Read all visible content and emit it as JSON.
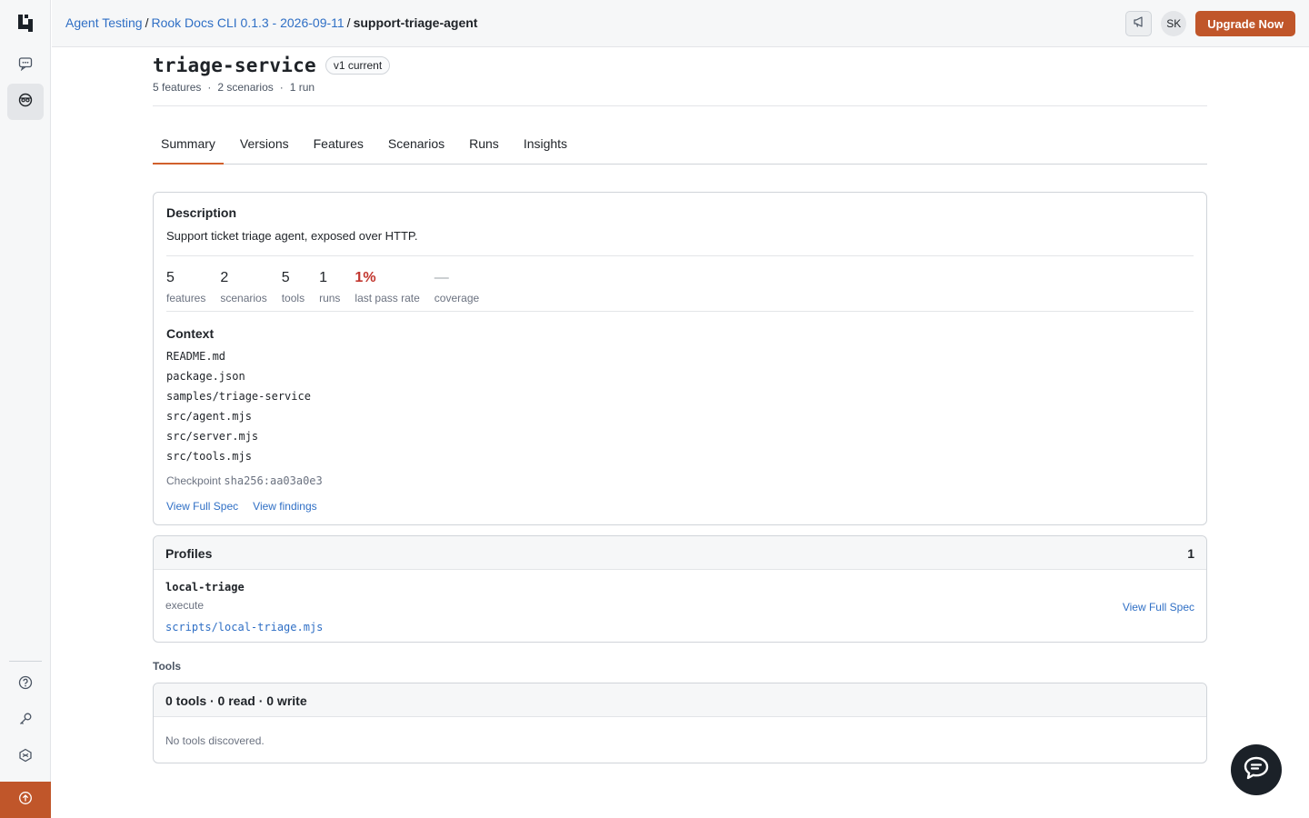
{
  "breadcrumb": {
    "items": [
      "Agent Testing",
      "Rook Docs CLI 0.1.3 - 2026-09-11"
    ],
    "separator": "/",
    "current": "support-triage-agent"
  },
  "header": {
    "avatar_initials": "SK",
    "upgrade_label": "Upgrade Now"
  },
  "service": {
    "title": "triage-service",
    "version_badge": "v1 current",
    "meta": [
      "5 features",
      "2 scenarios",
      "1 run"
    ],
    "meta_separator": "·"
  },
  "tabs": [
    {
      "label": "Summary",
      "active": true
    },
    {
      "label": "Versions"
    },
    {
      "label": "Features"
    },
    {
      "label": "Scenarios"
    },
    {
      "label": "Runs"
    },
    {
      "label": "Insights"
    }
  ],
  "summary": {
    "description_title": "Description",
    "description": "Support ticket triage agent, exposed over HTTP.",
    "stats": [
      {
        "value": "5",
        "label": "features"
      },
      {
        "value": "2",
        "label": "scenarios"
      },
      {
        "value": "5",
        "label": "tools"
      },
      {
        "value": "1",
        "label": "runs"
      },
      {
        "value": "1%",
        "label": "last pass rate"
      },
      {
        "value": "—",
        "label": "coverage"
      }
    ],
    "context_title": "Context",
    "context_files": [
      "README.md",
      "package.json",
      "samples/triage-service",
      "src/agent.mjs",
      "src/server.mjs",
      "src/tools.mjs"
    ],
    "checkpoint_label": "Checkpoint",
    "checkpoint_value": "sha256:aa03a0e3",
    "link_spec": "View Full Spec",
    "link_findings": "View findings"
  },
  "profiles": {
    "title": "Profiles",
    "count": "1",
    "items": [
      {
        "name": "local-triage",
        "mode": "execute",
        "path": "scripts/local-triage.mjs",
        "link": "View Full Spec"
      }
    ]
  },
  "tools": {
    "label": "Tools",
    "summary": "0 tools · 0 read · 0 write",
    "empty": "No tools discovered."
  },
  "colors": {
    "accent": "#c0562a",
    "link": "#2f6fc5",
    "danger": "#c2362e",
    "tab_underline": "#d1602c"
  },
  "icons": [
    "logo-icon",
    "chat-icon",
    "agent-icon",
    "help-icon",
    "key-icon",
    "integrations-icon",
    "upgrade-icon",
    "megaphone-icon",
    "support-chat-icon"
  ]
}
